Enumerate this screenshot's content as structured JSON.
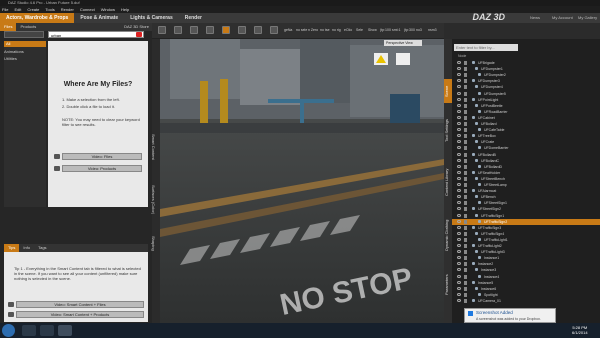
{
  "window_title": "DAZ Studio 4.6 Pro - Urban Future 5.duf",
  "menu": [
    "File",
    "Edit",
    "Create",
    "Tools",
    "Render",
    "Connect",
    "Window",
    "Help"
  ],
  "main_tabs": [
    "Actors, Wardrobe & Props",
    "Pose & Animate",
    "Lights & Cameras",
    "Render"
  ],
  "brand": "DAZ 3D",
  "top_links": [
    "News",
    "My Account",
    "My Gallery"
  ],
  "toolbar_labels": [
    "geNa",
    "no sele",
    "n Zero",
    "no tse",
    "no rig",
    "eCtio",
    "Sele",
    "Show",
    "(tp:100",
    "smt:1",
    "(tp:300",
    "no3",
    "nsm3"
  ],
  "left_panel": {
    "tabs": [
      "Files",
      "Products"
    ],
    "daz_store_label": "DAZ 3D Store",
    "search_value": "urban",
    "categories": [
      {
        "label": "All",
        "active": true
      },
      {
        "label": "Animations"
      },
      {
        "label": "Utilities"
      }
    ],
    "where_title": "Where Are My Files?",
    "instructions": [
      "1. Make a selection from the left.",
      "2. Double click a file to load it."
    ],
    "note": "NOTE: You may need to clear your keyword filter to see results.",
    "buttons": [
      "Video: Files",
      "Video: Products"
    ],
    "vertical_tabs": [
      "Smart Content",
      "Surfaces (Color)",
      "Shaping"
    ]
  },
  "tips": {
    "tabs": [
      "Tips",
      "Info",
      "Tags"
    ],
    "tip_text": "Tip 1 - Everything in the Smart Content tab is filtered to what is selected in the scene. If you want to see all your content (unfiltered) make sure nothing is selected in the scene.",
    "buttons": [
      "Video: Smart Content + Files",
      "Video: Smart Content + Products"
    ]
  },
  "viewport": {
    "perspective_label": "Perspective View",
    "road_text": "NO STOP"
  },
  "right_tabs": [
    "Scene",
    "Tool Settings",
    "Content Library",
    "Dynamic Clothing",
    "Parameters"
  ],
  "scene": {
    "search_placeholder": "Enter text to filter by...",
    "column_header": "Node",
    "rows": [
      "UFBrigade",
      "UFDumpster1",
      "UFDumpster2",
      "UFDumpster3",
      "UFDumpster4",
      "UFDumpster5",
      "UFPointLight",
      "UFPostBeetle",
      "UFRoadBarrier",
      "UFCabinet",
      "UFBollard",
      "UFCafeTable",
      "UFTreeBox",
      "UFCrate",
      "UFDomeBarrier",
      "UFBollardB",
      "UFBollardC",
      "UFBollardD",
      "UFSeatHolder",
      "UFStreetBench",
      "UFStreetLamp",
      "UFAlarmcat",
      "UFBench",
      "UFStreetSign1",
      "UFStreetSign2",
      "UFTrafficSign1",
      "UFTrafficSign2",
      "UFTrafficSign3",
      "UFTrafficSign4",
      "UFTrafficLight1",
      "UFTrafficLight2",
      "UFTrafficLight3",
      "Instance1",
      "Instance2",
      "Instance3",
      "Instance4",
      "Instance5",
      "Instance6",
      "Spotlight",
      "UFCamera_01"
    ],
    "selected_row": "UFTrafficSign2"
  },
  "notification": {
    "title": "Screenshot Added",
    "body": "A screenshot was added to your Dropbox."
  },
  "clock": {
    "time": "5:28 PM",
    "date": "6/1/2014"
  },
  "colors": {
    "accent": "#c87a16"
  }
}
